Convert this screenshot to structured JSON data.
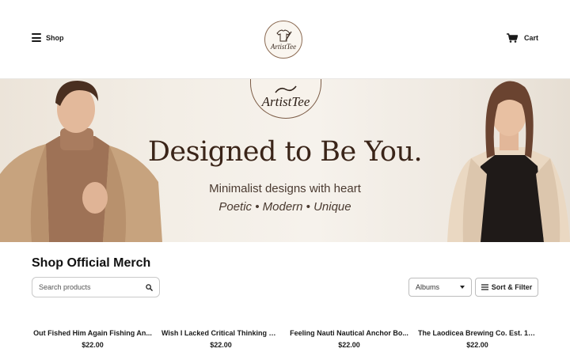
{
  "header": {
    "menu_label": "Shop",
    "logo_text": "ArtistTee",
    "cart_label": "Cart"
  },
  "hero": {
    "logo_text": "ArtistTee",
    "title": "Designed to Be You.",
    "subtitle": "Minimalist designs with heart",
    "tags": "Poetic • Modern • Unique"
  },
  "shop": {
    "title": "Shop Official Merch",
    "search_placeholder": "Search products",
    "filter_selected": "Albums",
    "sort_label": "Sort & Filter"
  },
  "products": [
    {
      "name": "Out Fished Him Again Fishing An...",
      "price": "$22.00"
    },
    {
      "name": "Wish I Lacked Critical Thinking Sk...",
      "price": "$22.00"
    },
    {
      "name": "Feeling Nauti Nautical Anchor Bo...",
      "price": "$22.00"
    },
    {
      "name": "The Laodicea Brewing Co. Est. 1st ...",
      "price": "$22.00"
    }
  ],
  "colors": {
    "accent_brown": "#3a2418",
    "text_dark": "#1a1a1a"
  }
}
